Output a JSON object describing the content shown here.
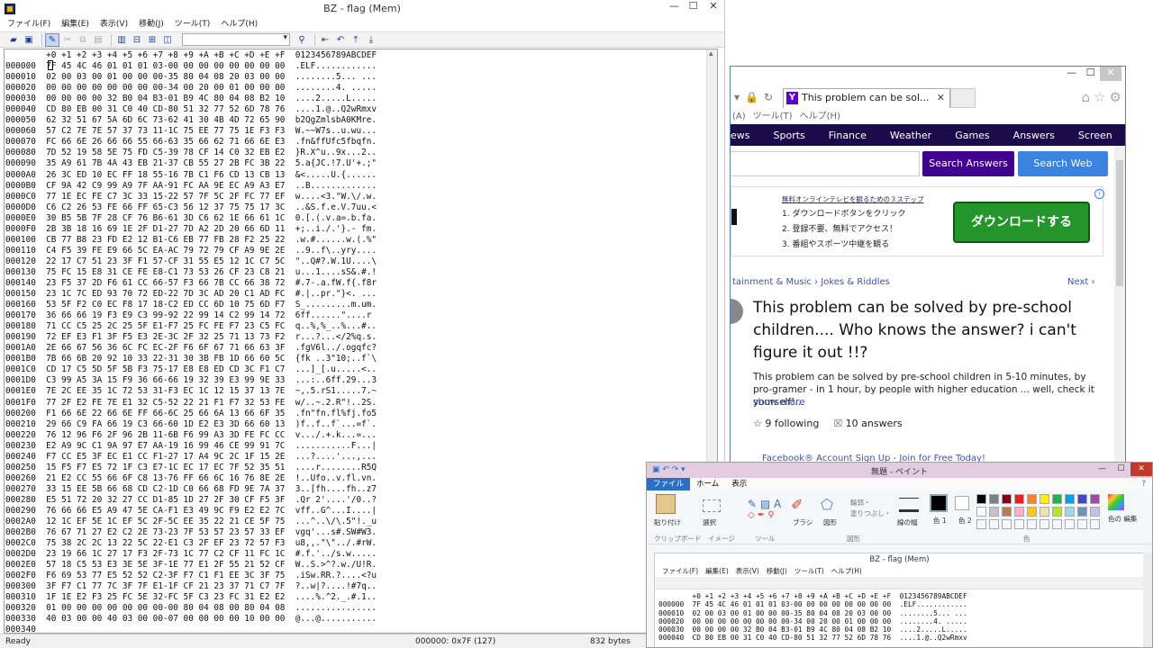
{
  "bz": {
    "title": "BZ - flag (Mem)",
    "menu": [
      "ファイル(F)",
      "編集(E)",
      "表示(V)",
      "移動(J)",
      "ツール(T)",
      "ヘルプ(H)"
    ],
    "hex_header": "+0 +1 +2 +3 +4 +5 +6 +7 +8 +9 +A +B +C +D +E +F  0123456789ABCDEF",
    "rows": [
      "000000  7F 45 4C 46 01 01 01 03-00 00 00 00 00 00 00 00  .ELF............",
      "000010  02 00 03 00 01 00 00 00-35 80 04 08 20 03 00 00  ........5... ...",
      "000020  00 00 00 00 00 00 00 00-34 00 20 00 01 00 00 00  ........4. .....",
      "000030  00 00 00 00 32 B0 04 B3-01 B9 4C 80 04 08 B2 10  ....2.....L.....",
      "000040  CD 80 EB 00 31 C0 40 CD-80 51 32 77 52 6D 78 76  ....1.@..Q2wRmxv",
      "000050  62 32 51 67 5A 6D 6C 73-62 41 30 4B 4D 72 65 90  b2QgZmlsbA0KMre.",
      "000060  57 C2 7E 7E 57 37 73 11-1C 75 EE 77 75 1E F3 F3  W.~~W7s..u.wu...",
      "000070  FC 66 6E 26 66 66 55 66-63 35 66 62 71 66 6E E3  .fn&ffUfc5fbqfn.",
      "000080  7D 52 19 58 5E 75 FD C5-39 78 CF 14 C0 32 EB E2  }R.X^u..9x...2..",
      "000090  35 A9 61 7B 4A 43 EB 21-37 CB 55 27 2B FC 3B 22  5.a{JC.!7.U'+.;\"",
      "0000A0  26 3C ED 10 EC FF 18 55-16 7B C1 F6 CD 13 CB 13  &<.....U.{......",
      "0000B0  CF 9A 42 C9 99 A9 7F AA-91 FC AA 9E EC A9 A3 E7  ..B.............",
      "0000C0  77 1E EC FE C7 3C 33 15-22 57 7F 5C 2F FC 77 EF  w....<3.\"W.\\/.w.",
      "0000D0  C6 C2 26 53 FE 66 FF 65-C3 56 12 37 75 75 17 3C  ..&S.f.e.V.7uu.<",
      "0000E0  30 B5 5B 7F 28 CF 76 B6-61 3D C6 62 1E 66 61 1C  0.[.(.v.a=.b.fa.",
      "0000F0  2B 3B 18 16 69 1E 2F D1-27 7D A2 2D 20 66 6D 11  +;..i./.'}.- fm.",
      "000100  CB 77 B8 23 FD E2 12 B1-C6 EB 77 FB 28 F2 25 22  .w.#......w.(.%\"",
      "000110  C4 F5 39 FE E9 66 5C EA-AC 79 72 79 CF A9 9E 2E  ..9..f\\..yry....",
      "000120  22 17 C7 51 23 3F F1 57-CF 31 55 E5 12 1C C7 5C  \"..Q#?.W.1U....\\",
      "000130  75 FC 15 E8 31 CE FE E8-C1 73 53 26 CF 23 C8 21  u...1....sS&.#.!",
      "000140  23 F5 37 2D F6 61 CC 66-57 F3 66 7B CC 66 38 72  #.7-.a.fW.f{.f8r",
      "000150  23 1C 7C ED 93 70 72 ED-22 7D 3C AD 20 C1 AD FC  #.|..pr.\"}<. ...",
      "000160  53 5F F2 C0 EC F8 17 18-C2 ED CC 6D 10 75 6D F7  S_.........m.um.",
      "000170  36 66 66 19 F3 E9 C3 99-92 22 99 14 C2 99 14 72  6ff......\"....r",
      "000180  71 CC C5 25 2C 25 5F E1-F7 25 FC FE F7 23 C5 FC  q..%,%_..%...#..",
      "000190  72 EF E3 F1 3F F5 E3 2E-3C 2F 32 25 71 13 73 F2  r...?...</2%q.s.",
      "0001A0  2E 66 67 56 36 6C FC EC-2F F6 6F 67 71 66 63 3F  .fgV6l../.ogqfc?",
      "0001B0  7B 66 6B 20 92 10 33 22-31 30 3B FB 1D 66 60 5C  {fk ..3\"10;..f`\\",
      "0001C0  CD 17 C5 5D 5F 5B F3 75-17 E8 E8 ED CD 3C F1 C7  ...]_[.u.....<..",
      "0001D0  C3 99 A5 3A 15 F9 36 66-66 19 32 39 E3 99 9E 33  ...:..6ff.29...3",
      "0001E0  7E 2C EE 35 1C 72 53 31-F3 EC 1C 12 15 37 13 7E  ~,.5.rS1.....7.~",
      "0001F0  77 2F E2 FE 7E E1 32 C5-52 22 21 F1 F7 32 53 FE  w/..~.2.R\"!..2S.",
      "000200  F1 66 6E 22 66 6E FF 66-6C 25 66 6A 13 66 6F 35  .fn\"fn.fl%fj.fo5",
      "000210  29 66 C9 FA 66 19 C3 66-60 1D E2 E3 3D 66 60 13  )f..f..f`...=f`.",
      "000220  76 12 96 F6 2F 96 2B 11-6B F6 99 A3 3D FE FC CC  v.../.+.k...=...",
      "000230  E2 A9 9C C1 9A 97 E7 AA-19 16 99 46 CE 99 91 7C  ...........F...|",
      "000240  F7 CC E5 3F EC E1 CC F1-27 17 A4 9C 2C 1F 15 2E  ...?....'...,...",
      "000250  15 F5 F7 E5 72 1F C3 E7-1C EC 17 EC 7F 52 35 51  ....r........R5Q",
      "000260  21 E2 CC 55 66 6F C8 13-76 FF 66 6C 16 76 8E 2E  !..Ufo..v.fl.vn.",
      "000270  33 15 EE 5B 66 68 CD C2-1D C0 66 68 FD 9E 7A 37  3..[fh....fh..z7",
      "000280  E5 51 72 20 32 27 CC D1-85 1D 27 2F 30 CF F5 3F  .Qr 2'....'/0..?",
      "000290  76 66 66 E5 A9 47 5E CA-F1 E3 49 9C F9 E2 E2 7C  vff..G^...I....|",
      "0002A0  12 1C EF 5E 1C EF 5C 2F-5C EE 35 22 21 CE 5F 75  ...^..\\/\\.5\"!._u",
      "0002B0  76 67 71 27 E2 C2 2E 73-23 7F 53 57 23 57 33 EF  vgq'...s#.SW#W3.",
      "0002C0  75 38 2C 2C 13 22 5C 22-E1 C3 2F EF 23 72 57 F3  u8,,.\"\\\"../.#rW.",
      "0002D0  23 19 66 1C 27 17 F3 2F-73 1C 77 C2 CF 11 FC 1C  #.f.'../s.w.....",
      "0002E0  57 18 C5 53 E3 3E 5E 3F-1E 77 E1 2F 55 21 52 CF  W..S.>^?.w./U!R.",
      "0002F0  F6 69 53 77 E5 52 52 C2-3F F7 C1 F1 EE 3C 3F 75  .iSw.RR.?....<?u",
      "000300  3F F7 C1 77 7C 3F 7F E1-1F CF 21 23 37 71 C7 7F  ?..w|?....!#7q..",
      "000310  1F 1E E2 F3 25 FC 5E 32-FC 5F C3 23 FC 31 E2 E2  ....%.^2._.#.1..",
      "000320  01 00 00 00 00 00 00 00-00 80 04 08 00 80 04 08  ................",
      "000330  40 03 00 00 40 03 00 00-07 00 00 00 00 10 00 00  @...@...........",
      "000340"
    ],
    "status": {
      "ready": "Ready",
      "position": "000000: 0x7F (127)",
      "size": "832 bytes"
    }
  },
  "browser": {
    "tab_title": "This problem can be sol...",
    "menu": [
      "(A)",
      "ツール(T)",
      "ヘルプ(H)"
    ],
    "nav": [
      "ews",
      "Sports",
      "Finance",
      "Weather",
      "Games",
      "Answers",
      "Screen"
    ],
    "search_answers": "Search Answers",
    "search_web": "Search Web",
    "ad": {
      "heading": "無料オンラインテレビを観るための３ステップ",
      "steps": [
        "1. ダウンロードボタンをクリック",
        "2. 登録不要、無料でアクセス！",
        "3. 番組やスポーツ中継を観る"
      ],
      "button": "ダウンロードする"
    },
    "breadcrumb": "tainment & Music  ›  Jokes & Riddles",
    "next": "Next ›",
    "question": "This problem can be solved by pre-school children.... Who knows the answer? i can't figure it out !!?",
    "description": "This problem can be solved by pre-school children in 5-10 minutes, by pro-gramer - in 1 hour, by people with higher education ... well, check it yourself!...",
    "show_more": "show more",
    "following": "9 following",
    "answers": "10 answers",
    "footer_ad": "Facebook® Account Sign Up - Join for Free Today!"
  },
  "paint": {
    "title": "無題 - ペイント",
    "tabs": [
      "ファイル",
      "ホーム",
      "表示"
    ],
    "groups": [
      "クリップボード",
      "イメージ",
      "ツール",
      "図形",
      "色"
    ],
    "labels": [
      "貼り付け",
      "選択",
      "ブラシ",
      "図形",
      "線の幅",
      "色\n1",
      "色\n2",
      "色の\n編集",
      "輪郭・",
      "塗りつぶし・"
    ],
    "inner_title": "BZ - flag (Mem)",
    "inner_menu": [
      "ファイル(F)",
      "編集(E)",
      "表示(V)",
      "移動(J)",
      "ツール(T)",
      "ヘルプ(H)"
    ],
    "inner_rows": [
      "+0 +1 +2 +3 +4 +5 +6 +7 +8 +9 +A +B +C +D +E +F  0123456789ABCDEF",
      "000000  7F 45 4C 46 01 01 01 03-00 00 00 00 00 00 00 00  .ELF............",
      "000010  02 00 03 00 01 00 00 00-35 80 04 08 20 03 00 00  ........5... ...",
      "000020  00 00 00 00 00 00 00 00-34 00 20 00 01 00 00 00  ........4. .....",
      "000030  00 00 00 00 32 B0 04 B3-01 B9 4C 80 04 08 B2 10  ....2.....L.....",
      "000040  CD 80 EB 00 31 C0 40 CD-80 51 32 77 52 6D 78 76  ....1.@..Q2wRmxv"
    ]
  },
  "colors": {
    "nav_bg": "#1c0b4b",
    "answers_btn": "#400090",
    "web_btn": "#3a83e0",
    "ad_btn": "#23952a",
    "paint_tab": "#2c70c6"
  }
}
